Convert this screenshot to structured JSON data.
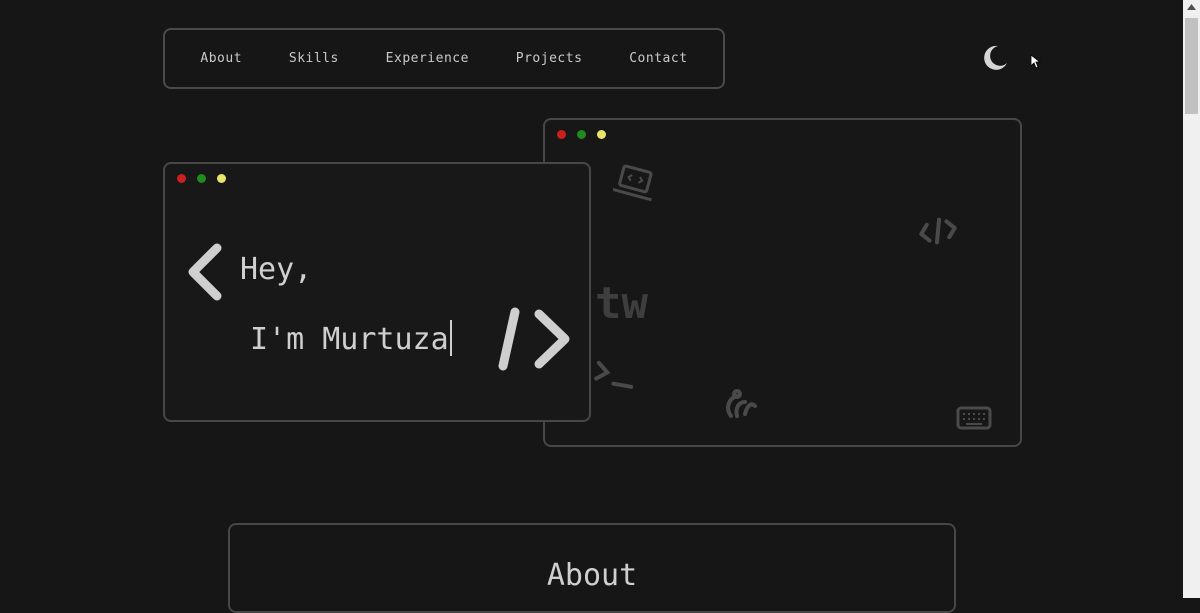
{
  "nav": {
    "items": [
      {
        "label": "About"
      },
      {
        "label": "Skills"
      },
      {
        "label": "Experience"
      },
      {
        "label": "Projects"
      },
      {
        "label": "Contact"
      }
    ]
  },
  "theme_toggle": {
    "icon": "moon-icon"
  },
  "hero": {
    "greeting": "Hey,",
    "name_line": "I'm Murtuza",
    "decor_text": "tw",
    "decor_prompt": ">_",
    "icons": [
      "laptop-code-icon",
      "code-icon",
      "terminal-icon",
      "git-branch-icon",
      "keyboard-icon"
    ]
  },
  "about": {
    "title": "About"
  },
  "colors": {
    "background": "#161616",
    "border": "#474747",
    "text": "#c9c9c9",
    "dot_red": "#cc1f1f",
    "dot_green": "#1f8a1f",
    "dot_yellow": "#e8e56a"
  }
}
